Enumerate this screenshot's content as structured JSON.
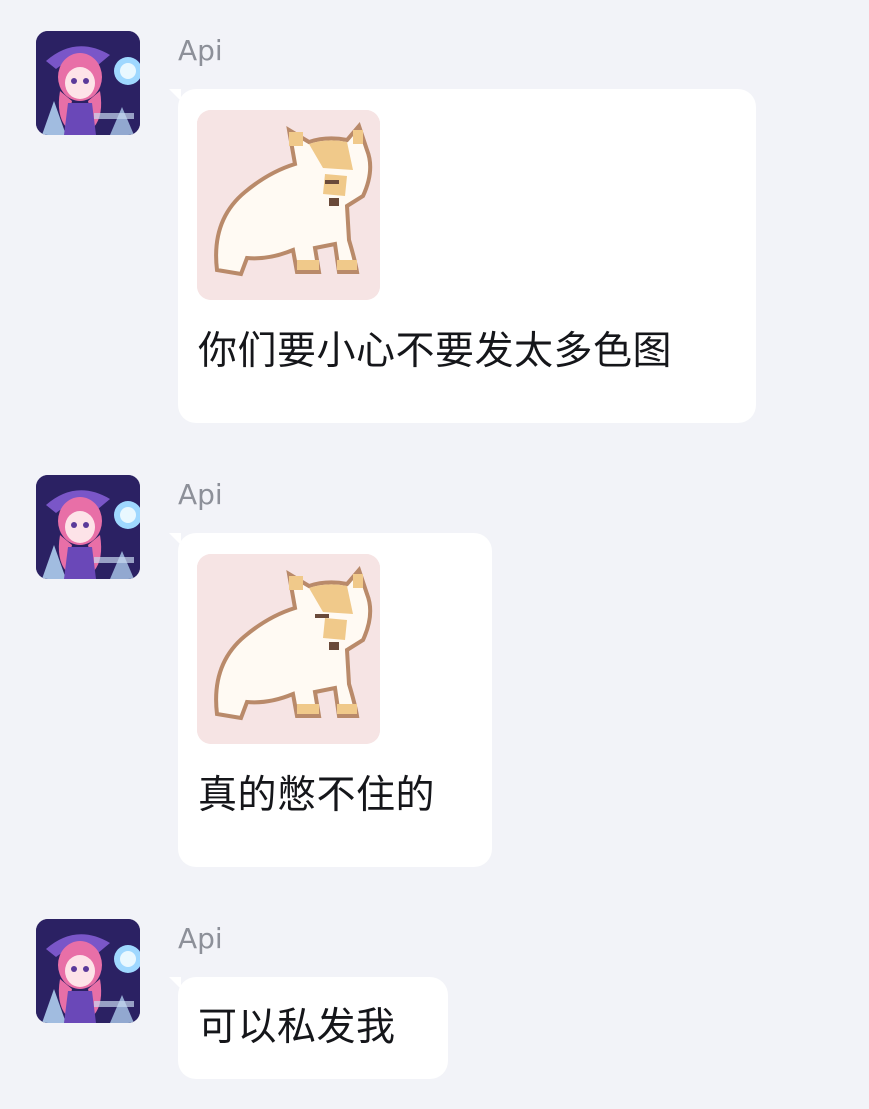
{
  "colors": {
    "background": "#f2f3f8",
    "bubble": "#ffffff",
    "sender_name": "#8d9099",
    "message_text": "#15161a"
  },
  "messages": [
    {
      "sender": "Api",
      "avatar_icon": "anime-girl-avatar",
      "sticker_icon": "pixel-cat-sticker",
      "text": "你们要小心不要发太多色图"
    },
    {
      "sender": "Api",
      "avatar_icon": "anime-girl-avatar",
      "sticker_icon": "pixel-cat-sticker",
      "text": "真的憋不住的"
    },
    {
      "sender": "Api",
      "avatar_icon": "anime-girl-avatar",
      "text": "可以私发我"
    }
  ]
}
